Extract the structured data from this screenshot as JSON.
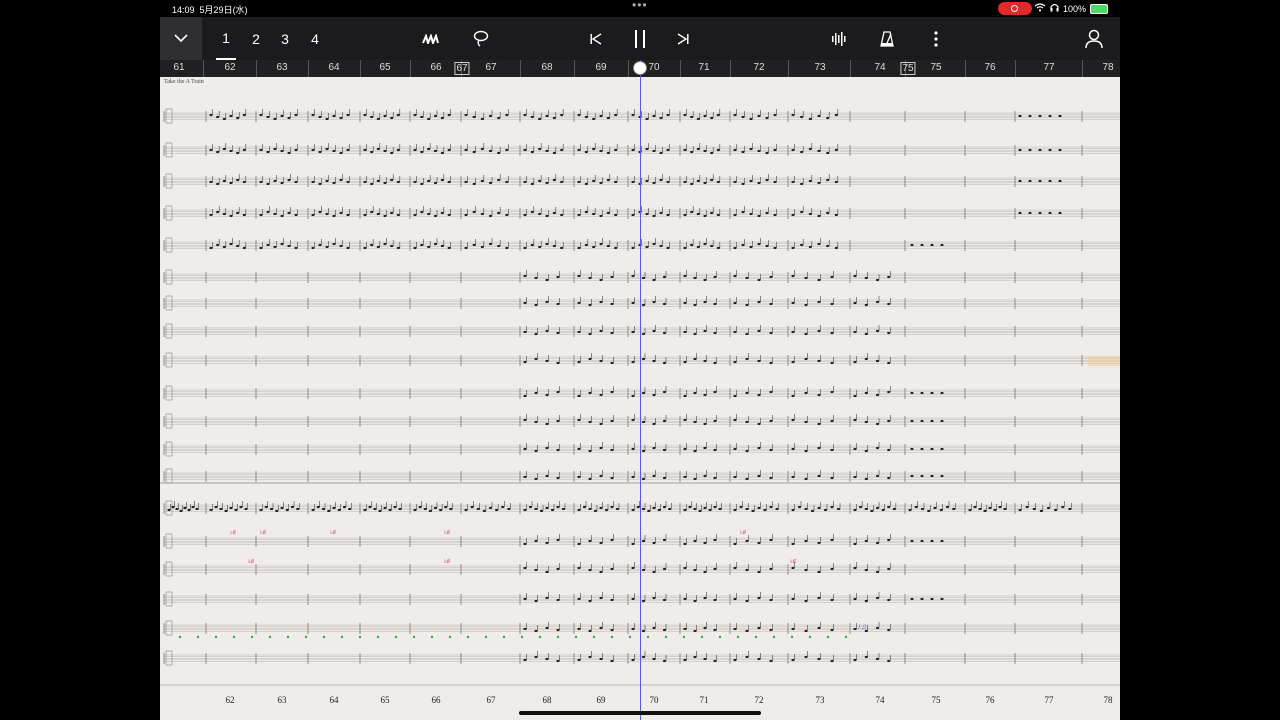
{
  "status_bar": {
    "time": "14:09",
    "date": "5月29日(水)",
    "battery": "100%",
    "icons": [
      "record-indicator-icon",
      "wifi-icon",
      "headphones-icon",
      "battery-icon"
    ]
  },
  "toolbar": {
    "collapse_icon": "chevron-down-icon",
    "pages": [
      "1",
      "2",
      "3",
      "4"
    ],
    "active_page": "1",
    "tools": [
      "mixer-icon",
      "lasso-icon"
    ],
    "transport": [
      "skip-back-icon",
      "pause-icon",
      "skip-forward-icon"
    ],
    "right_tools": [
      "waveform-icon",
      "metronome-icon",
      "more-icon",
      "account-icon"
    ]
  },
  "ruler": {
    "measures": [
      "61",
      "62",
      "63",
      "64",
      "65",
      "66",
      "67",
      "67",
      "68",
      "69",
      "70",
      "71",
      "72",
      "73",
      "74",
      "75",
      "75",
      "76",
      "77",
      "78"
    ],
    "rehearsal_marks": [
      "67",
      "75"
    ],
    "current": "70"
  },
  "score": {
    "title": "Take the A Train",
    "bottom_measures": [
      "62",
      "63",
      "64",
      "65",
      "66",
      "67",
      "68",
      "69",
      "70",
      "71",
      "72",
      "73",
      "74",
      "75",
      "76",
      "77",
      "78"
    ]
  },
  "colors": {
    "toolbar_bg": "#1b1b1d",
    "paper": "#efecea",
    "playhead": "#5a5ae0",
    "record": "#e02a2a",
    "battery": "#4cd964"
  }
}
